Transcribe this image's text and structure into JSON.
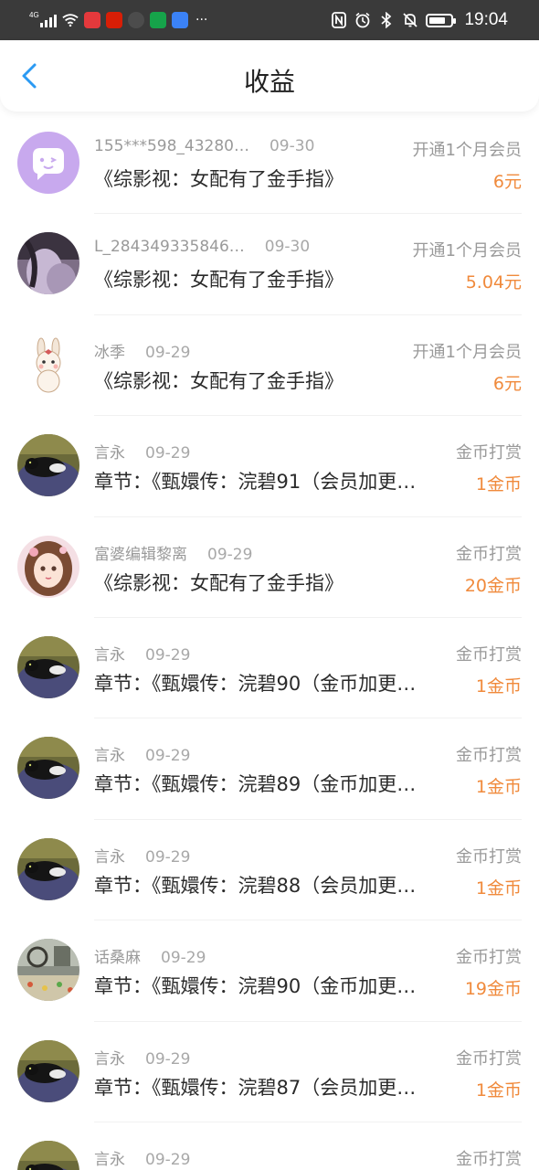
{
  "status_bar": {
    "signal_label": "4G",
    "time": "19:04",
    "more": "···",
    "battery_level": 0.75,
    "app_icon_colors": [
      "#e4393c",
      "#d81e06",
      "#4c4c4c",
      "#16a34a",
      "#3b82f6"
    ]
  },
  "header": {
    "title": "收益"
  },
  "colors": {
    "accent": "#2b9af3",
    "amount": "#f08a3c"
  },
  "records": [
    {
      "name": "155***598_43280…",
      "date": "09-30",
      "type": "开通1个月会员",
      "desc": "《综影视：女配有了金手指》",
      "amount": "6元",
      "avatar": "chat-bubble"
    },
    {
      "name": "L_284349335846…",
      "date": "09-30",
      "type": "开通1个月会员",
      "desc": "《综影视：女配有了金手指》",
      "amount": "5.04元",
      "avatar": "photo-purple"
    },
    {
      "name": "冰季",
      "date": "09-29",
      "type": "开通1个月会员",
      "desc": "《综影视：女配有了金手指》",
      "amount": "6元",
      "avatar": "bunny"
    },
    {
      "name": "言永",
      "date": "09-29",
      "type": "金币打赏",
      "desc": "章节：《甄嬛传：浣碧91（会员加更…",
      "amount": "1金币",
      "avatar": "cat"
    },
    {
      "name": "富婆编辑黎离",
      "date": "09-29",
      "type": "金币打赏",
      "desc": "《综影视：女配有了金手指》",
      "amount": "20金币",
      "avatar": "girl"
    },
    {
      "name": "言永",
      "date": "09-29",
      "type": "金币打赏",
      "desc": "章节：《甄嬛传：浣碧90（金币加更…",
      "amount": "1金币",
      "avatar": "cat"
    },
    {
      "name": "言永",
      "date": "09-29",
      "type": "金币打赏",
      "desc": "章节：《甄嬛传：浣碧89（金币加更…",
      "amount": "1金币",
      "avatar": "cat"
    },
    {
      "name": "言永",
      "date": "09-29",
      "type": "金币打赏",
      "desc": "章节：《甄嬛传：浣碧88（会员加更…",
      "amount": "1金币",
      "avatar": "cat"
    },
    {
      "name": "话桑麻",
      "date": "09-29",
      "type": "金币打赏",
      "desc": "章节：《甄嬛传：浣碧90（金币加更…",
      "amount": "19金币",
      "avatar": "room"
    },
    {
      "name": "言永",
      "date": "09-29",
      "type": "金币打赏",
      "desc": "章节：《甄嬛传：浣碧87（会员加更…",
      "amount": "1金币",
      "avatar": "cat"
    },
    {
      "name": "言永",
      "date": "09-29",
      "type": "金币打赏",
      "desc": "",
      "amount": "",
      "avatar": "cat"
    }
  ]
}
